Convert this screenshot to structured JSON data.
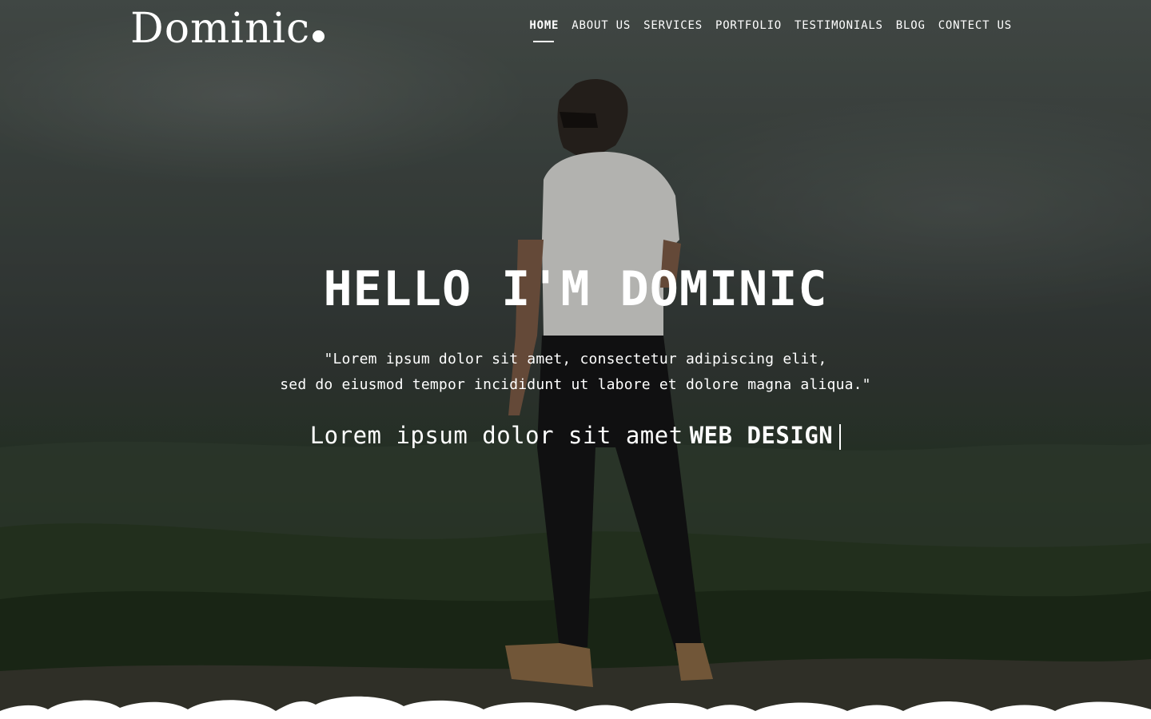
{
  "brand": {
    "name": "Dominic"
  },
  "nav": {
    "items": [
      {
        "label": "HOME"
      },
      {
        "label": "ABOUT US"
      },
      {
        "label": "SERVICES"
      },
      {
        "label": "PORTFOLIO"
      },
      {
        "label": "TESTIMONIALS"
      },
      {
        "label": "BLOG"
      },
      {
        "label": "CONTECT US"
      }
    ],
    "active": "HOME"
  },
  "hero": {
    "headline": "HELLO I'M DOMINIC",
    "quote_line1": "\"Lorem ipsum dolor sit amet, consectetur adipiscing elit,",
    "quote_line2": "sed do eiusmod tempor incididunt ut labore et dolore magna aliqua.\"",
    "typed_prefix": "Lorem ipsum dolor sit amet",
    "typed_word": "WEB DESIGN"
  },
  "colors": {
    "text": "#ffffff",
    "overlay": "#2a302c",
    "footer_wave": "#ffffff"
  }
}
